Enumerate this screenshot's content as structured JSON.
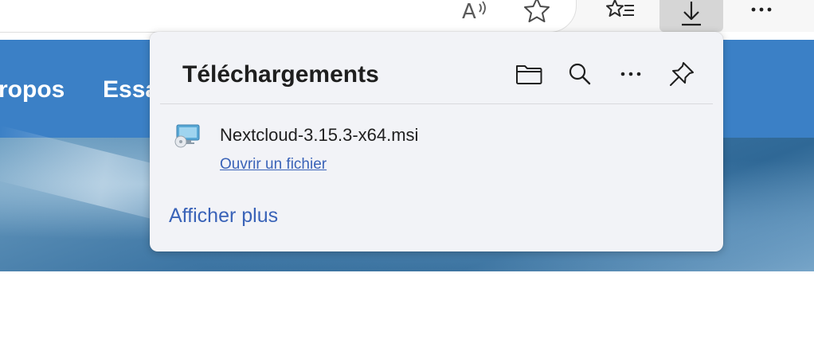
{
  "toolbar": {
    "icons": [
      "read-aloud-icon",
      "favorite-star-icon",
      "favorites-bar-icon",
      "download-icon",
      "more-tools-icon"
    ]
  },
  "site_nav": {
    "links": [
      "ropos",
      "Essa"
    ],
    "background": "#3b80c6"
  },
  "downloads": {
    "title": "Téléchargements",
    "header_icons": [
      "folder-icon",
      "search-icon",
      "more-icon",
      "pin-icon"
    ],
    "items": [
      {
        "file_name": "Nextcloud-3.15.3-x64.msi",
        "action_label": "Ouvrir un fichier",
        "icon": "installer-icon"
      }
    ],
    "show_more_label": "Afficher plus",
    "link_color": "#3a63b8"
  }
}
